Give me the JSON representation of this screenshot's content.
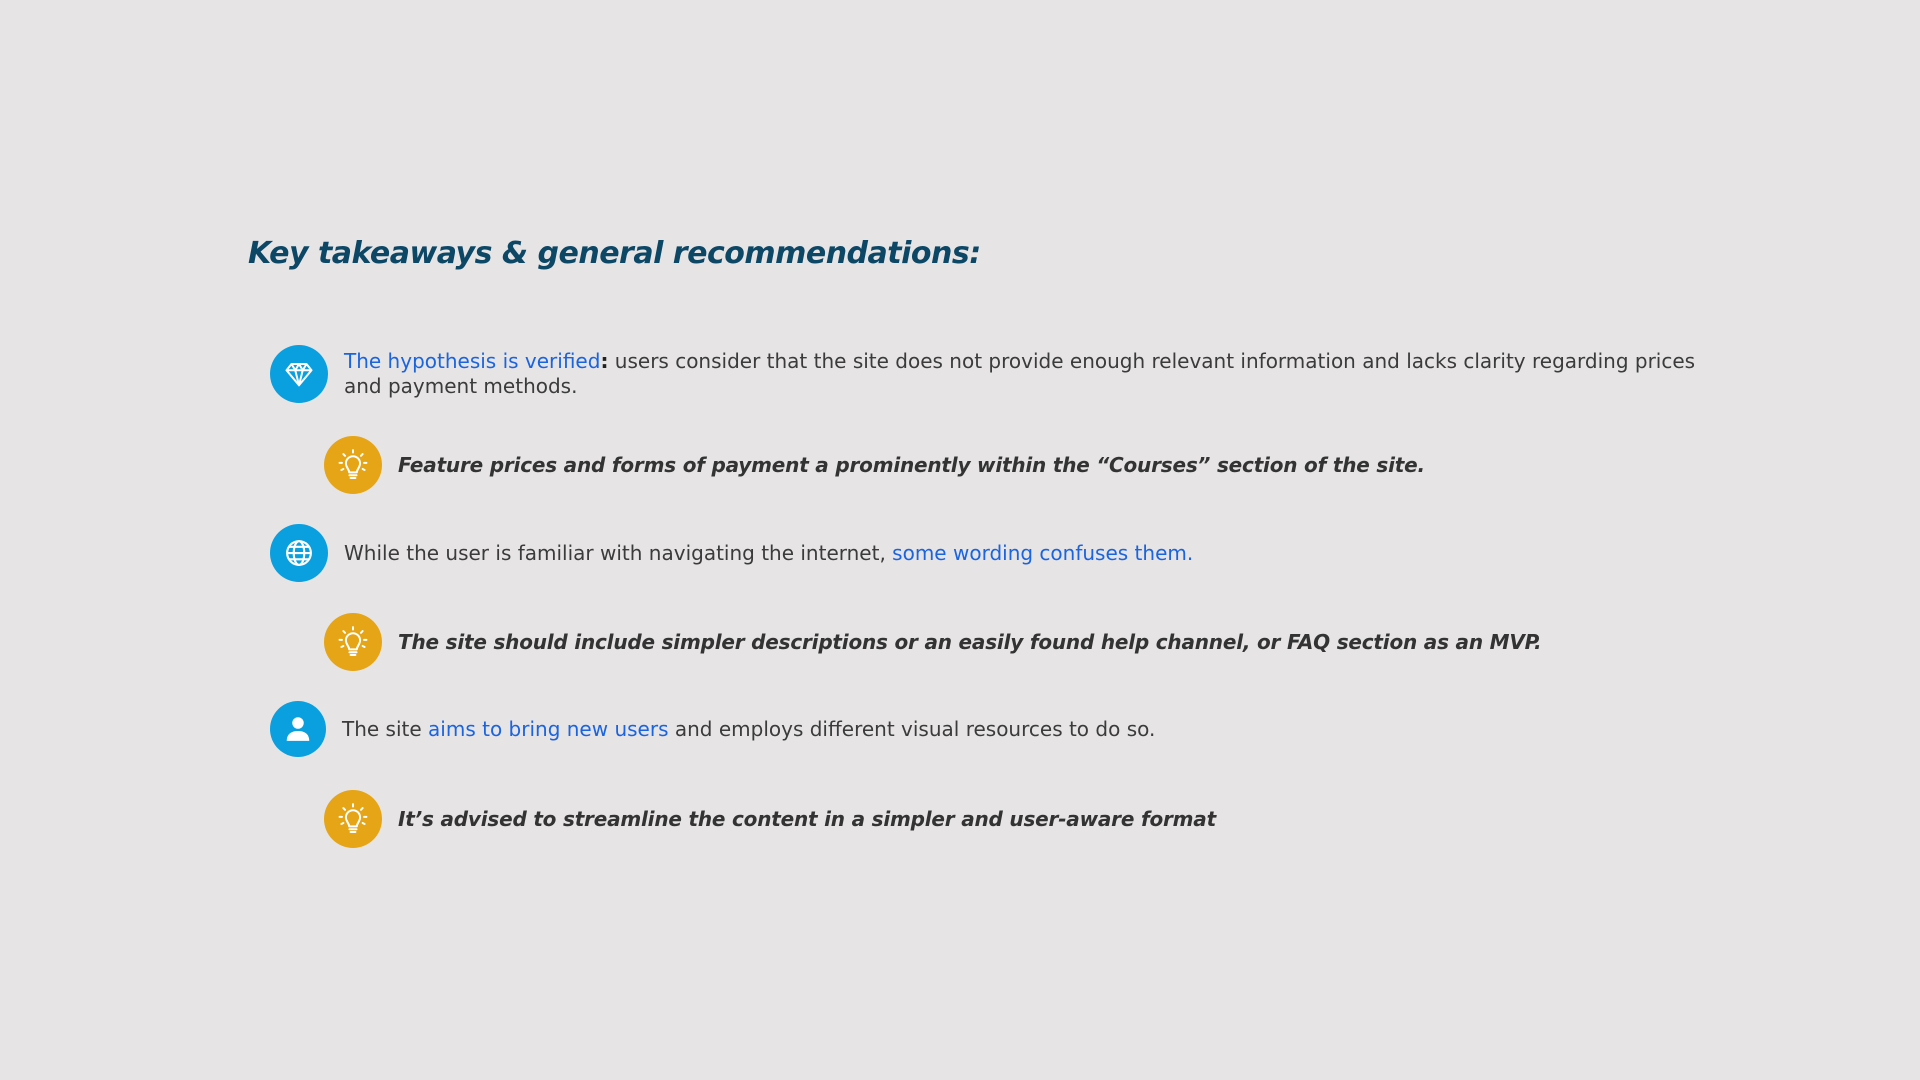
{
  "title": "Key takeaways & general recommendations:",
  "colors": {
    "background": "#e6e4e5",
    "title": "#0d4766",
    "highlight": "#1a64e0",
    "finding_icon_bg": "#0aa0e0",
    "advice_icon_bg": "#e6a516"
  },
  "findings": [
    {
      "icon": "diamond-icon",
      "highlight": "The hypothesis is verified",
      "colon": ":",
      "rest": " users consider that the site does not provide enough relevant information and lacks clarity regarding prices and payment methods."
    },
    {
      "icon": "globe-icon",
      "before": "While the user is familiar with navigating the internet, ",
      "highlight": "some wording confuses them."
    },
    {
      "icon": "user-icon",
      "before": "The site ",
      "highlight": "aims to bring new users",
      "after": " and employs different visual resources to do so."
    }
  ],
  "recommendations": [
    {
      "icon": "lightbulb-icon",
      "text": "Feature prices and forms of payment a prominently within the “Courses” section of the site."
    },
    {
      "icon": "lightbulb-icon",
      "text": "The site should include simpler descriptions or an easily found help channel, or FAQ section as an MVP."
    },
    {
      "icon": "lightbulb-icon",
      "text": "It’s advised to streamline the content in a simpler and user-aware format"
    }
  ]
}
